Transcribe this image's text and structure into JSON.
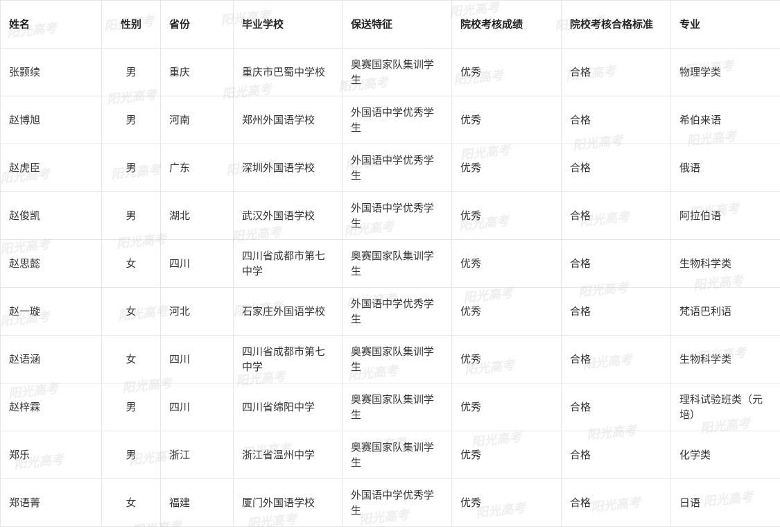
{
  "watermark": "阳光高考",
  "table": {
    "headers": [
      "姓名",
      "性别",
      "省份",
      "毕业学校",
      "保送特征",
      "院校考核成绩",
      "院校考核合格标准",
      "专业"
    ],
    "rows": [
      [
        "张颢续",
        "男",
        "重庆",
        "重庆市巴蜀中学校",
        "奥赛国家队集训学生",
        "优秀",
        "合格",
        "物理学类"
      ],
      [
        "赵博旭",
        "男",
        "河南",
        "郑州外国语学校",
        "外国语中学优秀学生",
        "优秀",
        "合格",
        "希伯来语"
      ],
      [
        "赵虎臣",
        "男",
        "广东",
        "深圳外国语学校",
        "外国语中学优秀学生",
        "优秀",
        "合格",
        "俄语"
      ],
      [
        "赵俊凯",
        "男",
        "湖北",
        "武汉外国语学校",
        "外国语中学优秀学生",
        "优秀",
        "合格",
        "阿拉伯语"
      ],
      [
        "赵思懿",
        "女",
        "四川",
        "四川省成都市第七中学",
        "奥赛国家队集训学生",
        "优秀",
        "合格",
        "生物科学类"
      ],
      [
        "赵一璇",
        "女",
        "河北",
        "石家庄外国语学校",
        "外国语中学优秀学生",
        "优秀",
        "合格",
        "梵语巴利语"
      ],
      [
        "赵语涵",
        "女",
        "四川",
        "四川省成都市第七中学",
        "奥赛国家队集训学生",
        "优秀",
        "合格",
        "生物科学类"
      ],
      [
        "赵梓霖",
        "男",
        "四川",
        "四川省绵阳中学",
        "奥赛国家队集训学生",
        "优秀",
        "合格",
        "理科试验班类（元培）"
      ],
      [
        "郑乐",
        "男",
        "浙江",
        "浙江省温州中学",
        "奥赛国家队集训学生",
        "优秀",
        "合格",
        "化学类"
      ],
      [
        "郑语菁",
        "女",
        "福建",
        "厦门外国语学校",
        "外国语中学优秀学生",
        "优秀",
        "合格",
        "日语"
      ]
    ]
  }
}
